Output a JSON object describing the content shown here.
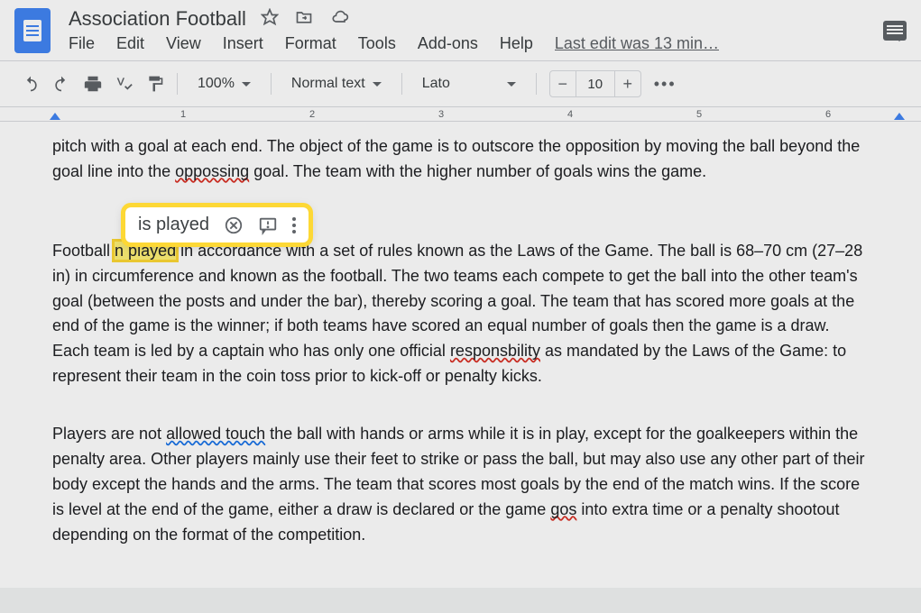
{
  "header": {
    "title": "Association Football",
    "menu": {
      "file": "File",
      "edit": "Edit",
      "view": "View",
      "insert": "Insert",
      "format": "Format",
      "tools": "Tools",
      "addons": "Add-ons",
      "help": "Help"
    },
    "last_edit": "Last edit was 13 min…"
  },
  "toolbar": {
    "zoom": "100%",
    "style": "Normal text",
    "font": "Lato",
    "font_size": "10"
  },
  "ruler": {
    "marks": [
      "1",
      "2",
      "3",
      "4",
      "5",
      "6"
    ]
  },
  "suggestion": {
    "text": "is played"
  },
  "document": {
    "p1_pre": "pitch with a goal at each end. The object of the game is to outscore the opposition by moving the ball beyond the goal line into the ",
    "p1_err": "oppossing",
    "p1_post": " goal. The team with the higher number of goals wins the game.",
    "p2_pre": "Football ",
    "p2_highlight": "n played",
    "p2_mid": " in accordance with a set of rules known as the Laws of the Game. The ball is 68–70 cm (27–28 in) in circumference and known as the football. The two teams each compete to get the ball into the other team's goal (between the posts and under the bar), thereby scoring a goal. The team that has scored more goals at the end of the game is the winner; if both teams have scored an equal number of goals then the game is a draw. Each team is led by a captain who has only one official ",
    "p2_err": "responsbility",
    "p2_post": " as mandated by the Laws of the Game: to represent their team in the coin toss prior to kick-off or penalty kicks.",
    "p3_pre": "Players are not ",
    "p3_gram": "allowed touch",
    "p3_mid": " the ball with hands or arms while it is in play, except for the goalkeepers within the penalty area. Other players mainly use their feet to strike or pass the ball, but may also use any other part of their body except the hands and the arms. The team that scores most goals by the end of the match wins. If the score is level at the end of the game, either a draw is declared or the game ",
    "p3_err": "gos",
    "p3_post": " into extra time or a penalty shootout depending on the format of the competition."
  }
}
